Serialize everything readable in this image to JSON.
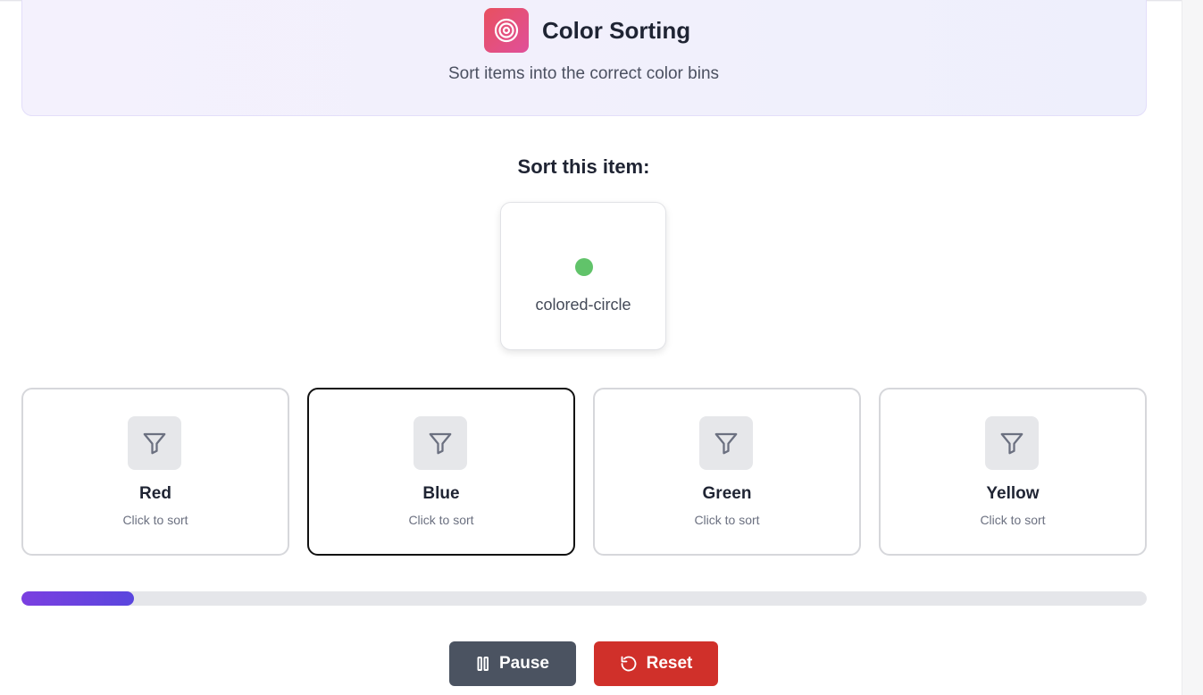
{
  "header": {
    "title": "Color Sorting",
    "subtitle": "Sort items into the correct color bins",
    "icon": "target-icon",
    "icon_gradient": [
      "#e8505f",
      "#e0509a"
    ]
  },
  "prompt": {
    "heading": "Sort this item:"
  },
  "current_item": {
    "label": "colored-circle",
    "color": "#61c36a"
  },
  "bins": [
    {
      "name": "Red",
      "hint": "Click to sort",
      "icon": "filter-icon",
      "selected": false
    },
    {
      "name": "Blue",
      "hint": "Click to sort",
      "icon": "filter-icon",
      "selected": true
    },
    {
      "name": "Green",
      "hint": "Click to sort",
      "icon": "filter-icon",
      "selected": false
    },
    {
      "name": "Yellow",
      "hint": "Click to sort",
      "icon": "filter-icon",
      "selected": false
    }
  ],
  "progress": {
    "fraction": 0.1,
    "gradient": [
      "#7b3fe0",
      "#5a46de"
    ]
  },
  "controls": {
    "pause_label": "Pause",
    "pause_icon": "pause-icon",
    "pause_color": "#4b5361",
    "reset_label": "Reset",
    "reset_icon": "reset-icon",
    "reset_color": "#d0302a"
  }
}
